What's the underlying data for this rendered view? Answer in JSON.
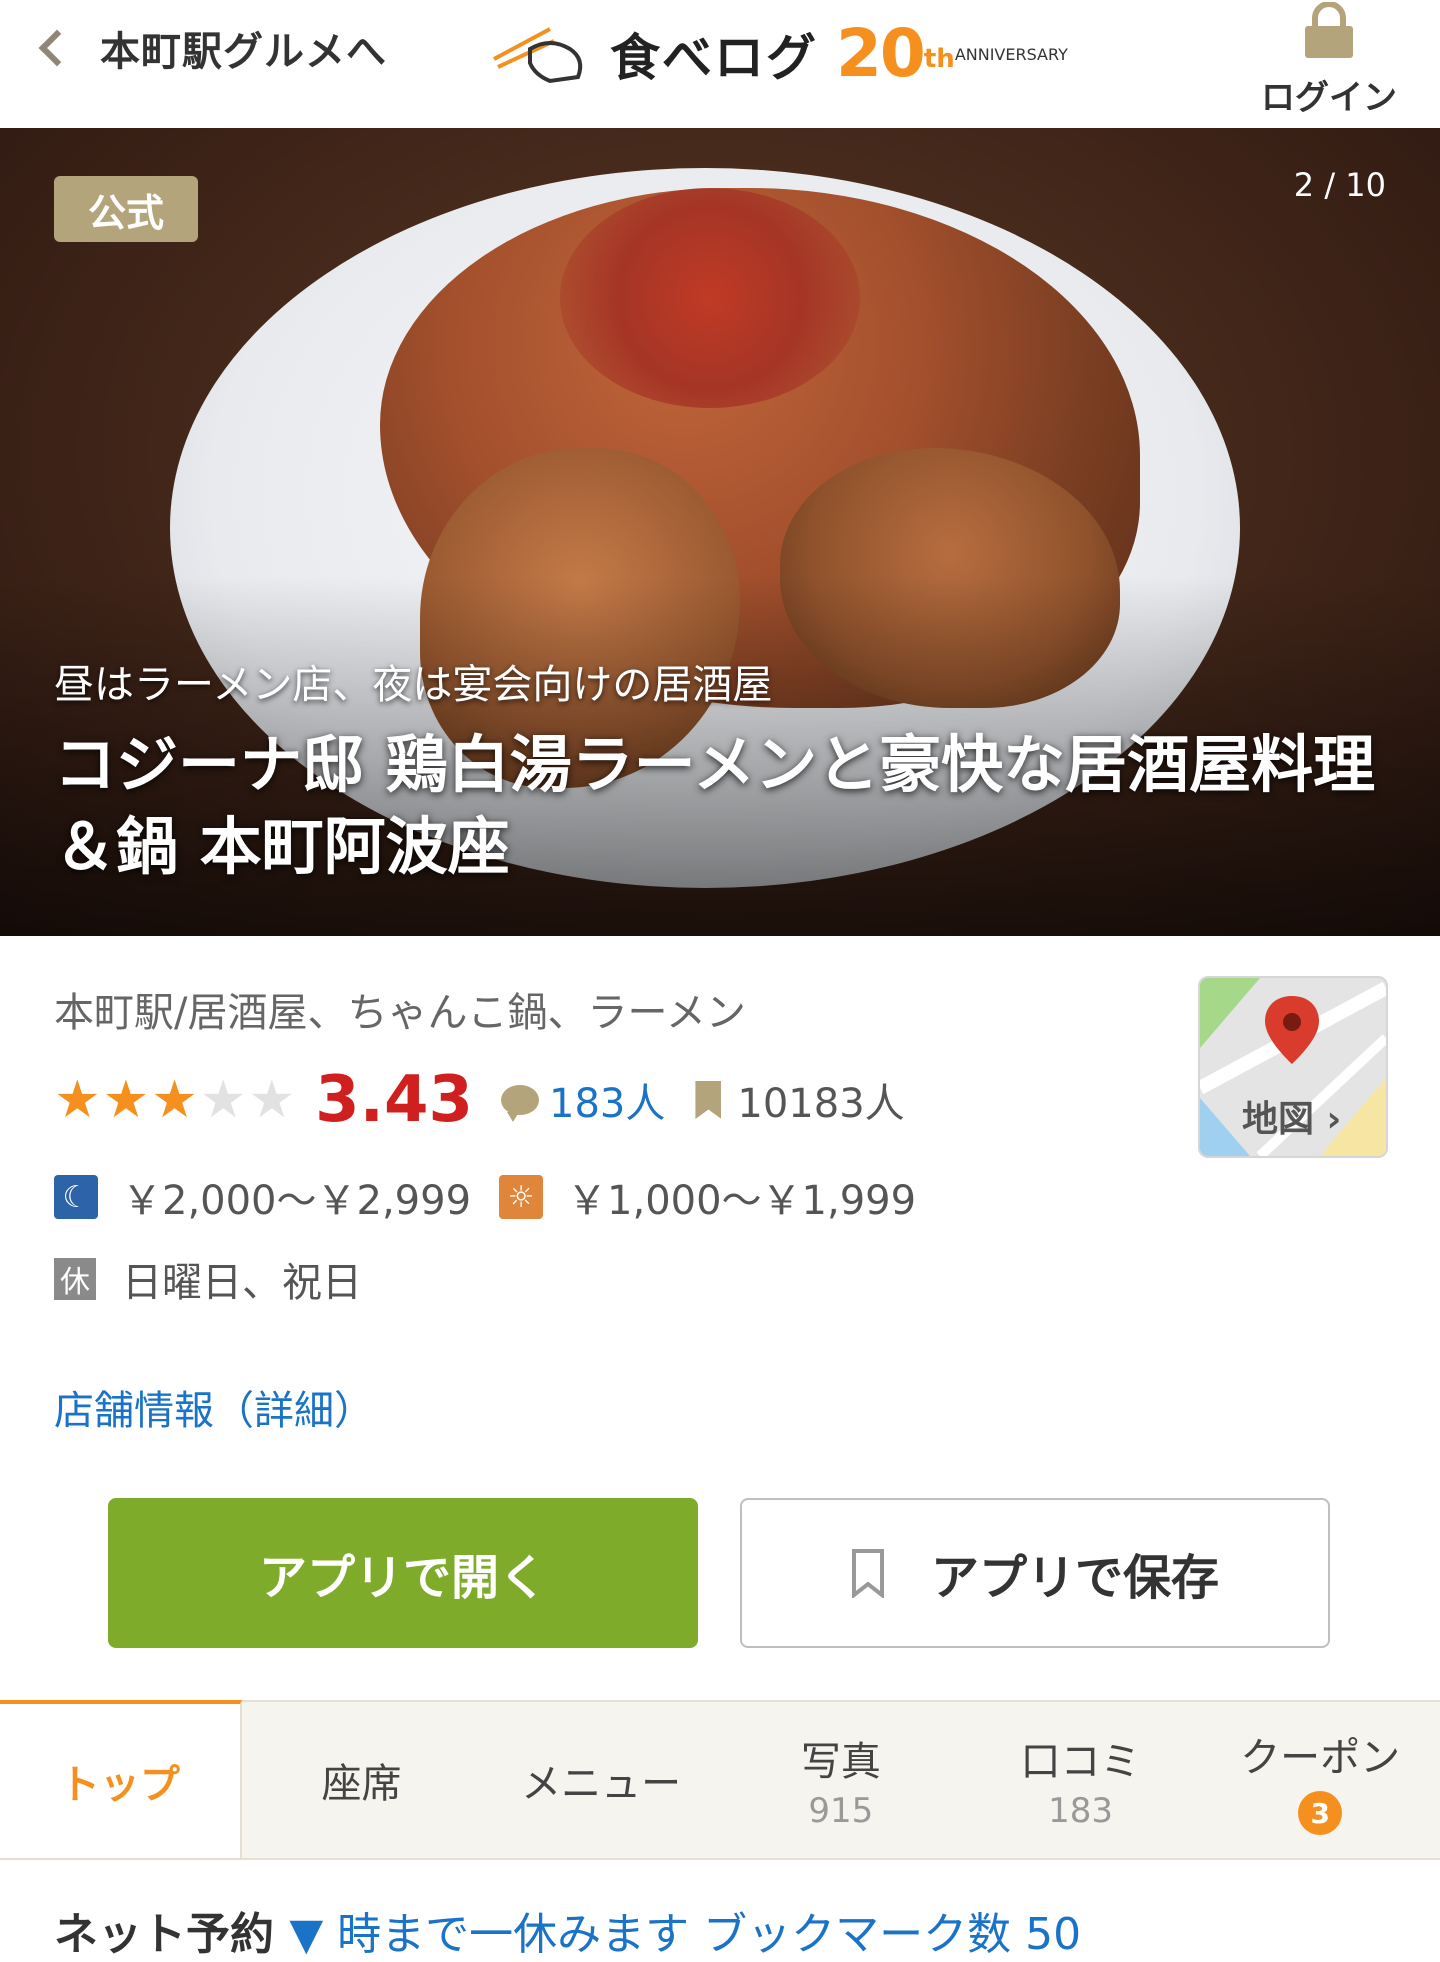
{
  "header": {
    "back_label": "本町駅グルメへ",
    "logo_text": "食べログ",
    "anniversary_number": "20",
    "anniversary_suffix": "th",
    "anniversary_word": "ANNIVERSARY",
    "login_label": "ログイン"
  },
  "hero": {
    "badge": "公式",
    "photo_counter": "2 / 10",
    "catch_copy": "昼はラーメン店、夜は宴会向けの居酒屋",
    "shop_name": "コジーナ邸 鶏白湯ラーメンと豪快な居酒屋料理＆鍋 本町阿波座"
  },
  "info": {
    "genre": "本町駅/居酒屋、ちゃんこ鍋、ラーメン",
    "rating": 3.43,
    "rating_text": "3.43",
    "star_count": 3,
    "review_count": "183人",
    "bookmark_count": "10183人",
    "dinner_price": "￥2,000〜￥2,999",
    "lunch_price": "￥1,000〜￥1,999",
    "holiday_icon_text": "休",
    "holidays": "日曜日、祝日",
    "map_label": "地図 ›",
    "detail_link": "店舗情報（詳細）"
  },
  "buttons": {
    "open_app": "アプリで開く",
    "save_app": "アプリで保存"
  },
  "tabs": [
    {
      "label": "トップ",
      "count": ""
    },
    {
      "label": "座席",
      "count": ""
    },
    {
      "label": "メニュー",
      "count": ""
    },
    {
      "label": "写真",
      "count": "915"
    },
    {
      "label": "口コミ",
      "count": "183"
    },
    {
      "label": "クーポン",
      "count": "3"
    }
  ],
  "bottom": {
    "peek_text": "ネット予約",
    "peek_link": "▼ 時まで一休みます ブックマーク数 50"
  },
  "colors": {
    "accent": "#f5901e",
    "gold": "#b3a47c",
    "score_red": "#d01f1f",
    "link_blue": "#1a73c7",
    "button_green": "#7fab2a"
  }
}
